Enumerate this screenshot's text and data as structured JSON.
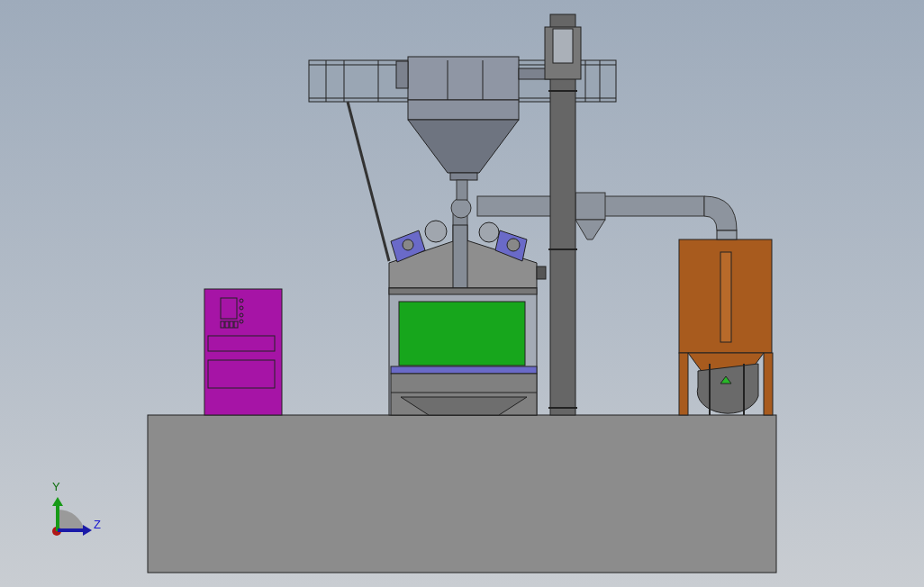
{
  "viewport": {
    "triad": {
      "y_label": "Y",
      "z_label": "Z"
    }
  }
}
